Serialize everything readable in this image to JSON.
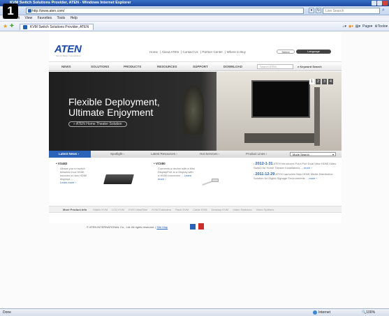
{
  "window": {
    "title": "KVM Switch Solutions Provider, ATEN - Windows Internet Explorer",
    "step_number": "1"
  },
  "address": {
    "url": "http://www.aten.com/",
    "search_placeholder": "Live Search"
  },
  "menu": [
    "File",
    "Edit",
    "View",
    "Favorites",
    "Tools",
    "Help"
  ],
  "tab": {
    "label": "KVM Switch Solutions Provider, ATEN"
  },
  "commands": {
    "page": "Page",
    "tools": "Tools"
  },
  "site": {
    "logo": "ATEN",
    "logo_tagline": "Simply Better Connections",
    "top_links": [
      "Home",
      "About ATEN",
      "Contact Us",
      "Partner Center",
      "Where to Buy"
    ],
    "select_label": "Select",
    "language_label": "Language",
    "nav": [
      "NEWS",
      "SOLUTIONS",
      "PRODUCTS",
      "RESOURCES",
      "SUPPORT",
      "DOWNLOAD"
    ],
    "search_placeholder": "Search ATEN",
    "keyword_search": "Keyword Search",
    "hero": {
      "line1": "Flexible Deployment,",
      "line2": "Ultimate Enjoyment",
      "button": "ATEN Home Theater Solution",
      "slides": [
        "1",
        "2",
        "3",
        "4"
      ]
    },
    "tabs": [
      "Latest News",
      "Spotlight",
      "Latest Resources",
      "Hot Services",
      "Product Lines"
    ],
    "mode_search": "Mode Search",
    "news": [
      {
        "title": "VS482",
        "text": "Allows you to switch between four HDMI sources on two HDMI displays ...",
        "more": "Learn more"
      },
      {
        "title": "VC080",
        "text": "Connects a device with a Mini DisplayPort to a Display with a HDMI connector ...",
        "more": "Learn more"
      },
      {
        "date1": "2012-1-31",
        "text1": "ATEN Introduces Four-Port Dual View HDMI Video Switch for Home Theater Installations ...",
        "more1": "more",
        "date2": "2011-12-29",
        "text2": "ATEN Launches New HDMI Media Distribution Solution for Digital Signage Environments ...",
        "more2": "more"
      }
    ],
    "more_info": {
      "label": "More Product Info",
      "items": [
        "Matrix KVM",
        "LCD KVM",
        "KVM Ultra/Slim",
        "KVM Extenders",
        "Rack KVM",
        "Cable KVM",
        "Desktop KVM",
        "Video Switches",
        "Video Splitters"
      ]
    },
    "footer": {
      "copyright": "© ATEN INTERNATIONAL Co., Ltd. All rights reserved.",
      "sitemap": "Site Map"
    }
  },
  "status": {
    "left": "Done",
    "zone": "Internet",
    "zoom": "100%"
  }
}
